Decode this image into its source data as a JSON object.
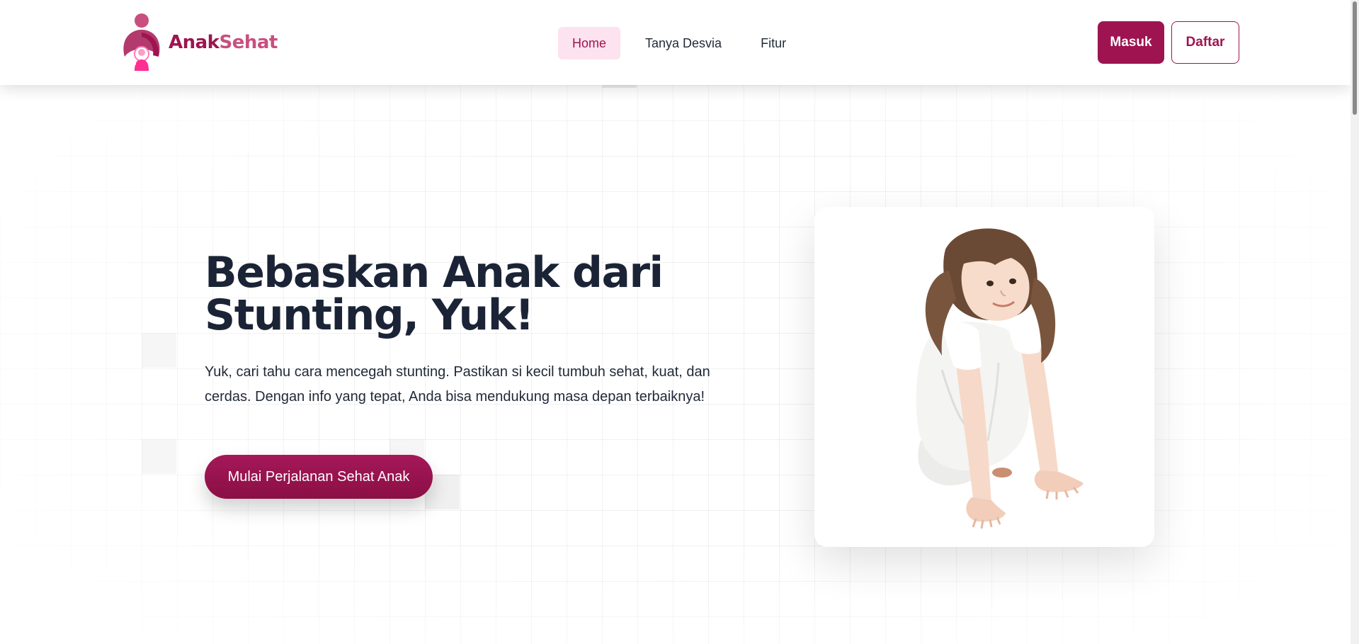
{
  "brand": {
    "name_part1": "Anak",
    "name_part2": "Sehat",
    "primary_color": "#9d1450",
    "secondary_color": "#c84f80",
    "accent_color": "#ff3d9a"
  },
  "navbar": {
    "links": [
      {
        "label": "Home",
        "active": true
      },
      {
        "label": "Tanya Desvia",
        "active": false
      },
      {
        "label": "Fitur",
        "active": false
      }
    ],
    "login_label": "Masuk",
    "register_label": "Daftar"
  },
  "hero": {
    "title_line1": "Bebaskan Anak dari",
    "title_line2": "Stunting, Yuk!",
    "description": "Yuk, cari tahu cara mencegah stunting. Pastikan si kecil tumbuh sehat, kuat, dan cerdas. Dengan info yang tepat, Anda bisa mendukung masa depan terbaiknya!",
    "cta_label": "Mulai Perjalanan Sehat Anak"
  },
  "icons": {
    "logo": "mother-child-logo-icon",
    "hero_image": "crawling-child-photo"
  }
}
